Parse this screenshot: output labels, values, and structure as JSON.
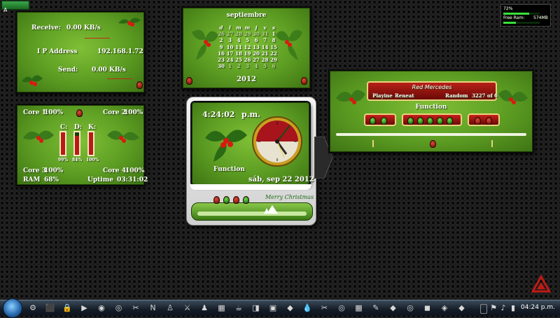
{
  "topbar": {
    "logo_letter": "A"
  },
  "ram_widget": {
    "cpu_percent": "72%",
    "free_ram_label": "Free Ram:",
    "free_ram_value": "574MB",
    "cpu_fill": 0.72,
    "ram_fill": 0.35
  },
  "network": {
    "receive_label": "Receive:",
    "receive_value": "0.00 KB/s",
    "ip_label": "I P Address",
    "ip_value": "192.168.1.72",
    "send_label": "Send:",
    "send_value": "0.00 KB/s"
  },
  "calendar": {
    "month": "septiembre",
    "year": "2012",
    "weekdays": [
      "d",
      "l",
      "m",
      "m",
      "j",
      "v",
      "s"
    ],
    "weeks": [
      [
        "26",
        "27",
        "28",
        "29",
        "30",
        "31",
        "1"
      ],
      [
        "2",
        "3",
        "4",
        "5",
        "6",
        "7",
        "8"
      ],
      [
        "9",
        "10",
        "11",
        "12",
        "13",
        "14",
        "15"
      ],
      [
        "16",
        "17",
        "18",
        "19",
        "20",
        "21",
        "22"
      ],
      [
        "23",
        "24",
        "25",
        "26",
        "27",
        "28",
        "29"
      ],
      [
        "30",
        "1",
        "2",
        "3",
        "4",
        "5",
        "6"
      ]
    ]
  },
  "system": {
    "core1_label": "Core 1:",
    "core1_value": "100%",
    "core2_label": "Core 2:",
    "core2_value": "100%",
    "core3_label": "Core 3:",
    "core3_value": "100%",
    "core4_label": "Core 4:",
    "core4_value": "100%",
    "ram_label": "RAM",
    "ram_value": "68%",
    "uptime_label": "Uptime",
    "uptime_value": "03:31:02",
    "drives": [
      {
        "label": "C:",
        "percent": "99%",
        "fill": 0.99
      },
      {
        "label": "D:",
        "percent": "84%",
        "fill": 0.84
      },
      {
        "label": "K:",
        "percent": "100%",
        "fill": 1.0
      }
    ]
  },
  "clock": {
    "time": "4:24:02",
    "ampm": "p.m.",
    "function_label": "Function",
    "date": "sáb, sep 22 2012",
    "greeting": "Merry Christmas"
  },
  "music": {
    "track": "Red Mercedes",
    "artist": "Playine",
    "artist2": "Reneat",
    "mode": "Random",
    "count": "3227 of 6",
    "function_label": "Function"
  },
  "taskbar": {
    "clock": "04:24 p.m.",
    "icons": [
      "⚙",
      "⬛",
      "🔒",
      "▶",
      "◉",
      "◎",
      "✂",
      "N",
      "♙",
      "⚔",
      "♟",
      "▦",
      "☕",
      "◨",
      "▣",
      "◆",
      "💧",
      "✂",
      "◎",
      "▦",
      "✎",
      "◆",
      "◎",
      "◼",
      "◈",
      "◆"
    ]
  },
  "colors": {
    "accent_green": "#5c9c22",
    "holly_red": "#c81a14",
    "gold": "#e8d480"
  }
}
